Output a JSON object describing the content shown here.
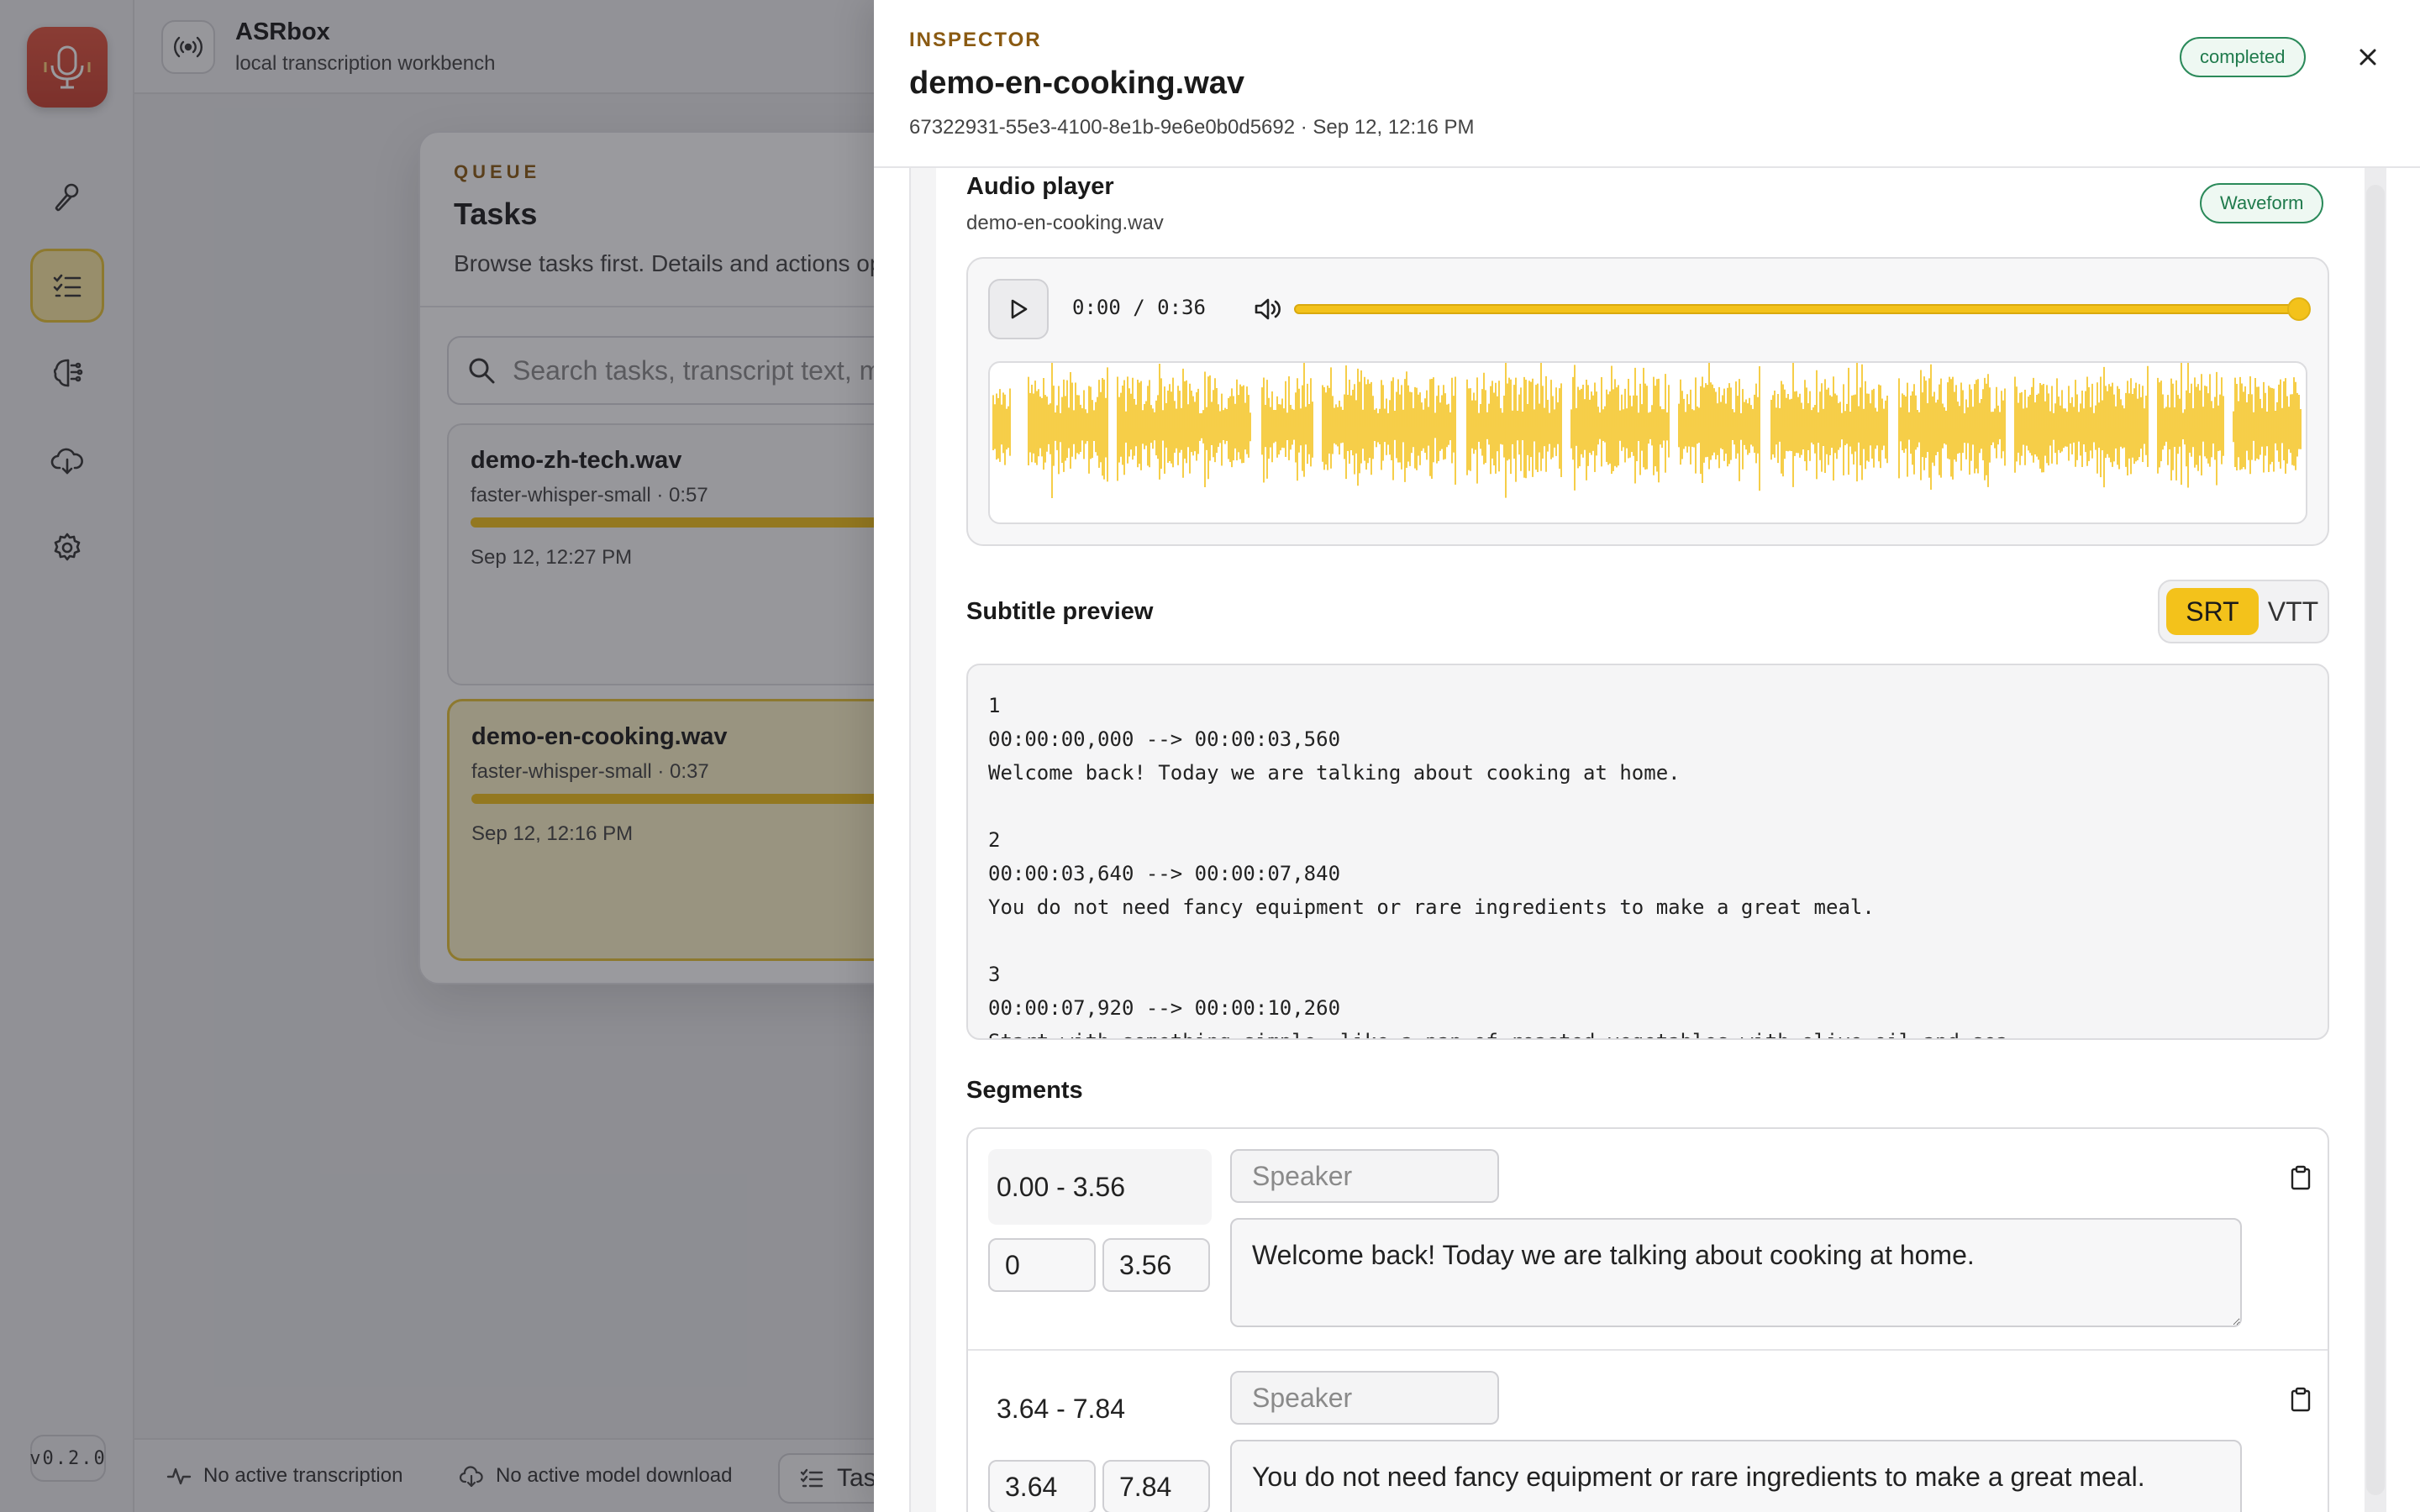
{
  "app": {
    "title": "ASRbox",
    "subtitle": "local transcription workbench",
    "version": "v0.2.0"
  },
  "rail": {
    "items": [
      {
        "icon": "microphone-icon",
        "active": false
      },
      {
        "icon": "task-list-icon",
        "active": true
      },
      {
        "icon": "model-brain-icon",
        "active": false
      },
      {
        "icon": "cloud-download-icon",
        "active": false
      },
      {
        "icon": "gear-icon",
        "active": false
      }
    ]
  },
  "queue": {
    "eyebrow": "QUEUE",
    "title": "Tasks",
    "description": "Browse tasks first. Details and actions open in the inspector.",
    "search_placeholder": "Search tasks, transcript text, model",
    "tasks": [
      {
        "name": "demo-zh-tech.wav",
        "meta": "faster-whisper-small · 0:57",
        "date": "Sep 12, 12:27 PM",
        "progress": 1.0
      },
      {
        "name": "demo-en-cooking.wav",
        "meta": "faster-whisper-small · 0:37",
        "date": "Sep 12, 12:16 PM",
        "progress": 1.0
      }
    ]
  },
  "statusbar": {
    "transcription": "No active transcription",
    "download": "No active model download",
    "tab_label": "Tasks"
  },
  "inspector": {
    "eyebrow": "INSPECTOR",
    "title": "demo-en-cooking.wav",
    "subtitle": "67322931-55e3-4100-8e1b-9e6e0b0d5692 · Sep 12, 12:16 PM",
    "status": "completed",
    "audio": {
      "title": "Audio player",
      "filename": "demo-en-cooking.wav",
      "mode_label": "Waveform",
      "time": "0:00 / 0:36",
      "seek_progress": 1.0
    },
    "subtitle_preview": {
      "title": "Subtitle preview",
      "formats": [
        "SRT",
        "VTT"
      ],
      "selected": "SRT",
      "content": "1\n00:00:00,000 --> 00:00:03,560\nWelcome back! Today we are talking about cooking at home.\n\n2\n00:00:03,640 --> 00:00:07,840\nYou do not need fancy equipment or rare ingredients to make a great meal.\n\n3\n00:00:07,920 --> 00:00:10,260\nStart with something simple, like a pan of roasted vegetables with olive oil and sea"
    },
    "segments": {
      "title": "Segments",
      "speaker_placeholder": "Speaker",
      "items": [
        {
          "range": "0.00 - 3.56",
          "start": "0",
          "end": "3.56",
          "text": "Welcome back! Today we are talking about cooking at home."
        },
        {
          "range": "3.64 - 7.84",
          "start": "3.64",
          "end": "7.84",
          "text": "You do not need fancy equipment or rare ingredients to make a great meal."
        }
      ]
    }
  },
  "colors": {
    "accent": "#f3c21b",
    "eyebrow": "#8a5a12",
    "success": "#1f7a4c"
  }
}
